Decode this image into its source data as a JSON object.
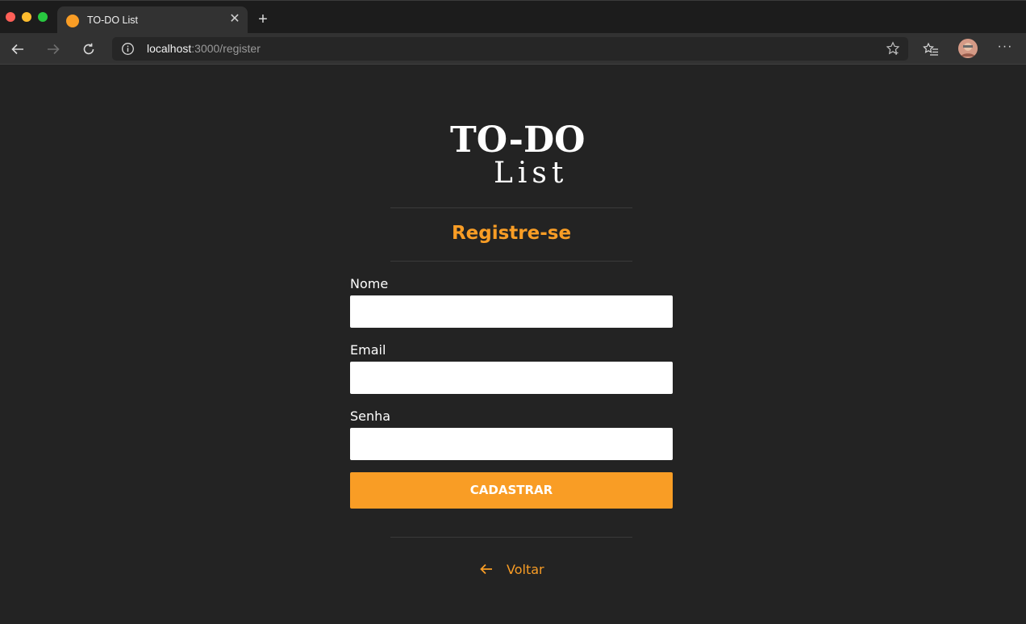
{
  "browser": {
    "tab": {
      "title": "TO-DO List",
      "favicon_color": "#f99d25"
    },
    "address": {
      "host": "localhost",
      "path": ":3000/register"
    },
    "icons": [
      "back-arrow-icon",
      "forward-arrow-icon",
      "reload-icon",
      "info-icon",
      "star-icon",
      "favorites-icon",
      "profile-avatar",
      "more-icon"
    ]
  },
  "page": {
    "logo": {
      "line1": "TO-DO",
      "line2": "List"
    },
    "title": "Registre-se",
    "fields": [
      {
        "label": "Nome",
        "value": "",
        "placeholder": ""
      },
      {
        "label": "Email",
        "value": "",
        "placeholder": ""
      },
      {
        "label": "Senha",
        "value": "",
        "placeholder": ""
      }
    ],
    "submit_label": "CADASTRAR",
    "back_label": "Voltar"
  },
  "colors": {
    "accent": "#f99d25",
    "background": "#232323",
    "text": "#ffffff"
  }
}
